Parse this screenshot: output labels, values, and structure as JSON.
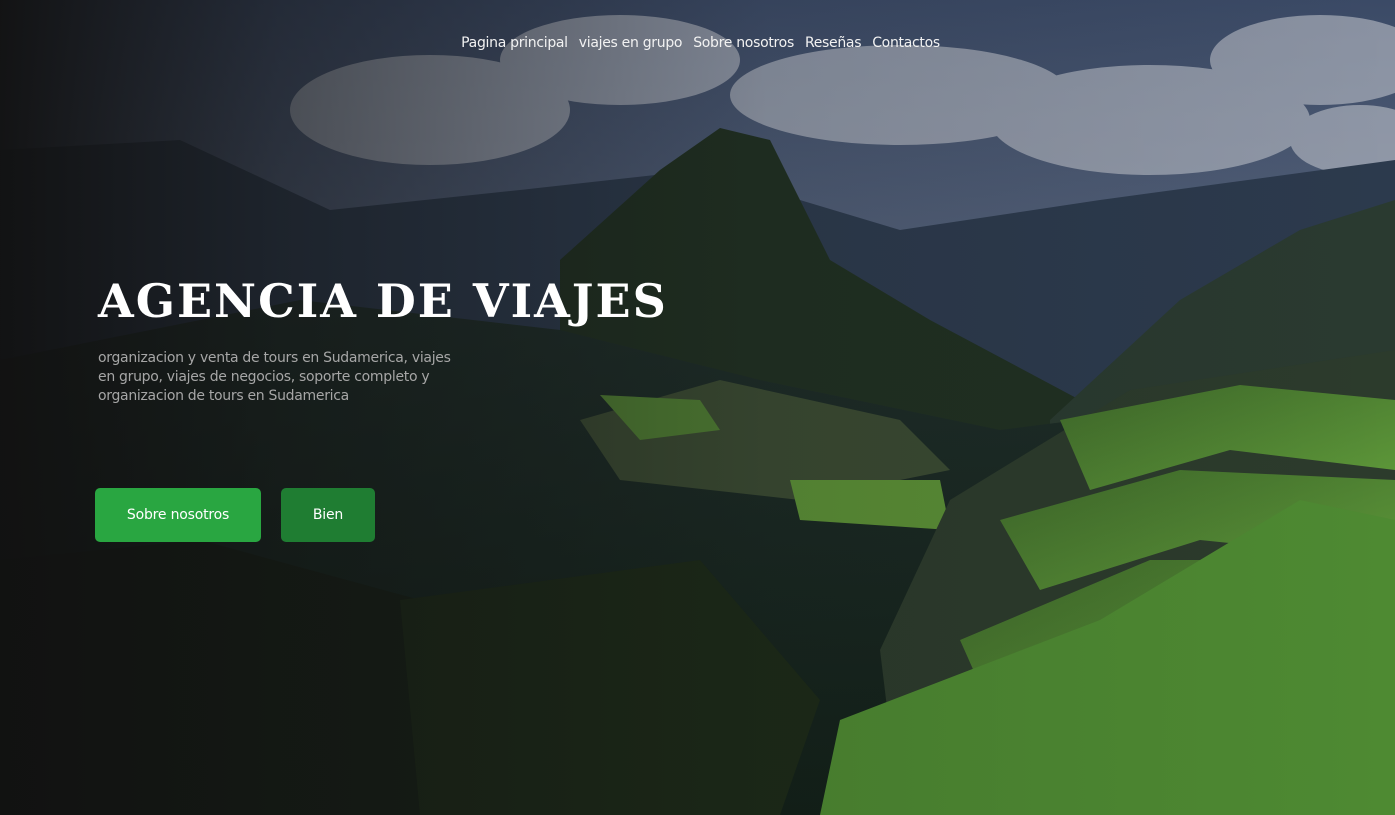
{
  "nav": {
    "items": [
      {
        "label": "Pagina principal"
      },
      {
        "label": "viajes en grupo"
      },
      {
        "label": "Sobre nosotros"
      },
      {
        "label": "Reseñas"
      },
      {
        "label": "Contactos"
      }
    ]
  },
  "hero": {
    "title": "AGENCIA DE VIAJES",
    "description": "organizacion y venta de tours en Sudamerica, viajes en grupo, viajes de negocios, soporte completo y organizacion de tours en Sudamerica",
    "buttons": {
      "about_label": "Sobre nosotros",
      "ok_label": "Bien"
    },
    "background": "machu-picchu-photo"
  },
  "colors": {
    "accent": "#29a641",
    "accent_dark": "#1f7d32",
    "background": "#111111"
  }
}
